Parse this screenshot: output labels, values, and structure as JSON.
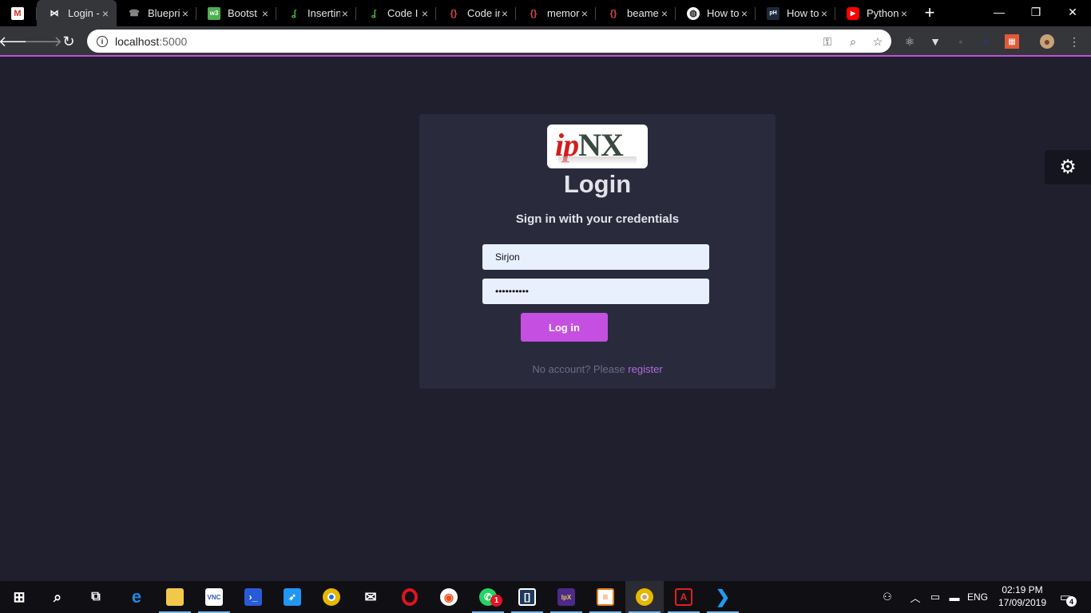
{
  "browser": {
    "tabs": [
      {
        "title": "",
        "icon": "gmail-icon",
        "color": "#d93025"
      },
      {
        "title": "Login - ",
        "icon": "bowtie-icon",
        "color": "#ffffff"
      },
      {
        "title": "Bluepri",
        "icon": "phone-icon",
        "color": "#000000"
      },
      {
        "title": "Bootst",
        "icon": "w3schools-icon",
        "color": "#4caf50"
      },
      {
        "title": "Insertin",
        "icon": "mongodb-leaf-icon",
        "color": "#4db33d"
      },
      {
        "title": "Code I",
        "icon": "mongodb-leaf-icon",
        "color": "#4db33d"
      },
      {
        "title": "Code in",
        "icon": "code-braces-icon",
        "color": "#e04848"
      },
      {
        "title": "memor",
        "icon": "code-braces-icon",
        "color": "#e04848"
      },
      {
        "title": "beame",
        "icon": "code-braces-icon",
        "color": "#e04848"
      },
      {
        "title": "How to",
        "icon": "globe-icon",
        "color": "#ffffff"
      },
      {
        "title": "How to",
        "icon": "pythonhow-icon",
        "color": "#1e2a3a"
      },
      {
        "title": "Python",
        "icon": "youtube-icon",
        "color": "#ff0000"
      }
    ],
    "url_host": "localhost",
    "url_port": ":5000"
  },
  "login": {
    "logo_ip": "ip",
    "logo_nx": "NX",
    "title": "Login",
    "subtitle": "Sign in with your credentials",
    "username_value": "Sirjon",
    "password_value": "••••••••••",
    "submit_label": "Log in",
    "register_prompt": "No account? Please ",
    "register_link": "register"
  },
  "taskbar": {
    "apps": [
      {
        "name": "start-button",
        "color": "#ffffff",
        "icon": "windows-icon"
      },
      {
        "name": "search-button",
        "color": "#ffffff",
        "icon": "search-icon"
      },
      {
        "name": "task-view-button",
        "color": "#ffffff",
        "icon": "task-view-icon"
      },
      {
        "name": "edge-app",
        "color": "#1e88e5",
        "icon": "edge-icon"
      },
      {
        "name": "file-explorer-app",
        "color": "#f2c84b",
        "icon": "folder-icon"
      },
      {
        "name": "vnc-app",
        "color": "#2e5bba",
        "icon": "vnc-icon"
      },
      {
        "name": "powershell-app",
        "color": "#2a5bd7",
        "icon": "powershell-icon"
      },
      {
        "name": "app-launcher-app",
        "color": "#2196f3",
        "icon": "rocket-icon"
      },
      {
        "name": "chrome-app",
        "color": "#e6b800",
        "icon": "chrome-icon"
      },
      {
        "name": "mail-app",
        "color": "#ffffff",
        "icon": "mail-icon"
      },
      {
        "name": "opera-app",
        "color": "#e0141e",
        "icon": "opera-icon"
      },
      {
        "name": "ubuntu-app",
        "color": "#e95420",
        "icon": "ubuntu-icon"
      },
      {
        "name": "whatsapp-app",
        "color": "#25d366",
        "icon": "whatsapp-icon"
      },
      {
        "name": "bracket-app",
        "color": "#3fa9f5",
        "icon": "bracket-icon"
      },
      {
        "name": "ipx-app",
        "color": "#4b2a8a",
        "icon": "ipx-icon"
      },
      {
        "name": "notes-app",
        "color": "#e67e22",
        "icon": "notes-icon"
      },
      {
        "name": "chrome-active-app",
        "color": "#e6b800",
        "icon": "chrome-profile-icon"
      },
      {
        "name": "acrobat-app",
        "color": "#e02020",
        "icon": "acrobat-icon"
      },
      {
        "name": "vscode-app",
        "color": "#1f9cf0",
        "icon": "vscode-icon"
      }
    ],
    "whatsapp_badge": "1",
    "language": "ENG",
    "time": "02:19 PM",
    "date": "17/09/2019",
    "notification_count": "4"
  }
}
